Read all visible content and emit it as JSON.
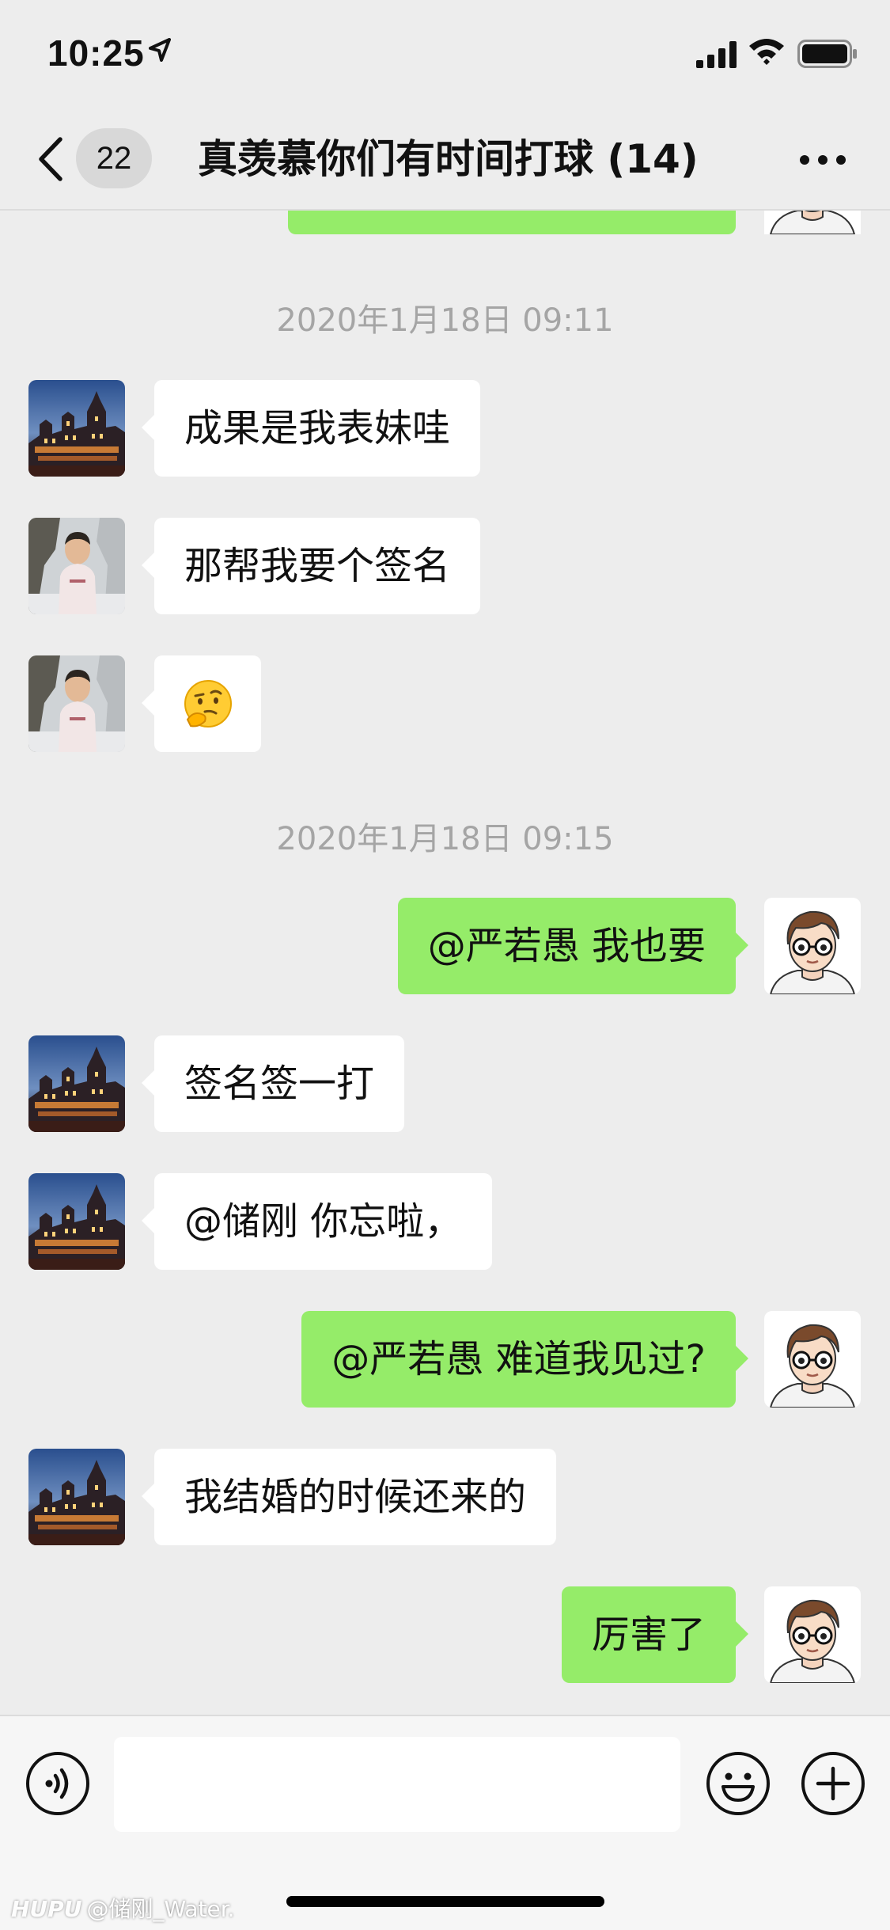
{
  "status_bar": {
    "time": "10:25"
  },
  "nav": {
    "back_badge": "22",
    "title": "真羡慕你们有时间打球 (14)"
  },
  "chat": {
    "timestamps": [
      "2020年1月18日 09:11",
      "2020年1月18日 09:15"
    ],
    "messages": [
      {
        "side": "left",
        "avatar": "castle-avatar",
        "text": "成果是我表妹哇"
      },
      {
        "side": "left",
        "avatar": "child-avatar",
        "text": "那帮我要个签名"
      },
      {
        "side": "left",
        "avatar": "child-avatar",
        "text": "",
        "emoji": "thinking-face-emoji"
      },
      {
        "side": "right",
        "avatar": "cartoon-avatar",
        "text": "@严若愚 我也要"
      },
      {
        "side": "left",
        "avatar": "castle-avatar",
        "text": "签名签一打"
      },
      {
        "side": "left",
        "avatar": "castle-avatar",
        "text": "@储刚 你忘啦，"
      },
      {
        "side": "right",
        "avatar": "cartoon-avatar",
        "text": "@严若愚 难道我见过?"
      },
      {
        "side": "left",
        "avatar": "castle-avatar",
        "text": "我结婚的时候还来的"
      },
      {
        "side": "right",
        "avatar": "cartoon-avatar",
        "text": "厉害了"
      }
    ]
  },
  "input_bar": {
    "icons": [
      "voice-icon",
      "emoji-icon",
      "plus-icon"
    ]
  },
  "watermark": {
    "brand": "HUPU",
    "user": "@储刚_Water."
  },
  "colors": {
    "background": "#ededed",
    "own_bubble": "#95ec69",
    "other_bubble": "#ffffff",
    "timestamp": "#a5a5a5"
  }
}
